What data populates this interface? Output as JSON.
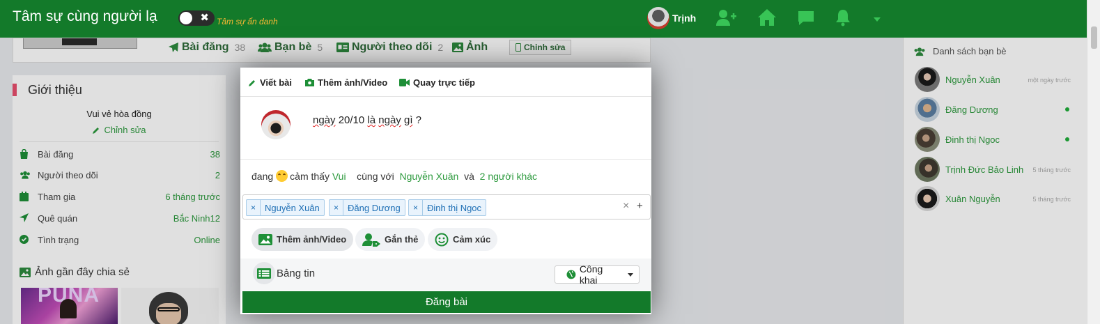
{
  "topbar": {
    "brand": "Tâm sự cùng người lạ",
    "anon_label": "Tâm sự ẩn danh",
    "user_name": "Trịnh",
    "colors": {
      "bar": "#137a2a",
      "anon": "#f7b733"
    }
  },
  "profile_nav": {
    "tabs": [
      {
        "label": "Bài đăng",
        "count": "38",
        "icon": "paper-plane-icon"
      },
      {
        "label": "Bạn bè",
        "count": "5",
        "icon": "users-icon"
      },
      {
        "label": "Người theo dõi",
        "count": "2",
        "icon": "id-card-icon"
      },
      {
        "label": "Ảnh",
        "count": "",
        "icon": "image-icon"
      }
    ],
    "edit_label": "Chỉnh sửa"
  },
  "intro": {
    "title": "Giới thiệu",
    "bio": "Vui vẻ hòa đồng",
    "edit_label": "Chỉnh sửa",
    "stats": [
      {
        "label": "Bài đăng",
        "value": "38",
        "icon": "shopping-bag-icon"
      },
      {
        "label": "Người theo dõi",
        "value": "2",
        "icon": "users-icon"
      },
      {
        "label": "Tham gia",
        "value": "6 tháng trước",
        "icon": "calendar-icon"
      },
      {
        "label": "Quê quán",
        "value": "Bắc Ninh12",
        "icon": "location-arrow-icon"
      },
      {
        "label": "Tình trạng",
        "value": "Online",
        "icon": "check-circle-icon"
      }
    ],
    "recent_photos_title": "Ảnh gần đây chia sẻ"
  },
  "friends": {
    "title": "Danh sách bạn bè",
    "items": [
      {
        "name": "Nguyễn Xuân",
        "time": "một ngày trước",
        "online": false
      },
      {
        "name": "Đăng Dương",
        "time": "",
        "online": true
      },
      {
        "name": "Đinh thị Ngoc",
        "time": "",
        "online": true
      },
      {
        "name": "Trịnh Đức Bảo Linh",
        "time": "5 tháng trước",
        "online": false
      },
      {
        "name": "Xuân Nguyễn",
        "time": "5 tháng trước",
        "online": false
      }
    ]
  },
  "composer": {
    "tabs": [
      {
        "label": "Viết bài",
        "icon": "pencil-icon"
      },
      {
        "label": "Thêm ảnh/Video",
        "icon": "camera-icon"
      },
      {
        "label": "Quay trực tiếp",
        "icon": "video-icon"
      }
    ],
    "text_before": "",
    "text_words": [
      "ngày",
      "20/10",
      "là",
      "ngày",
      "gì",
      "?"
    ],
    "feeling": {
      "prefix": "đang",
      "verb": "cảm thấy",
      "feeling": "Vui",
      "with": "cùng với",
      "friend": "Nguyễn Xuân",
      "and": "và",
      "others": "2 người khác"
    },
    "tags": [
      "Nguyễn Xuân",
      "Đăng Dương",
      "Đinh thị Ngoc"
    ],
    "tag_remove": "×",
    "tag_clear": "×",
    "tag_add": "+",
    "actions": [
      {
        "label": "Thêm ảnh/Video",
        "icon": "image-icon"
      },
      {
        "label": "Gắn thẻ",
        "icon": "user-tag-icon"
      },
      {
        "label": "Cảm xúc",
        "icon": "smile-icon"
      }
    ],
    "audience_label": "Bảng tin",
    "privacy": "Công khai",
    "submit": "Đăng bài"
  }
}
